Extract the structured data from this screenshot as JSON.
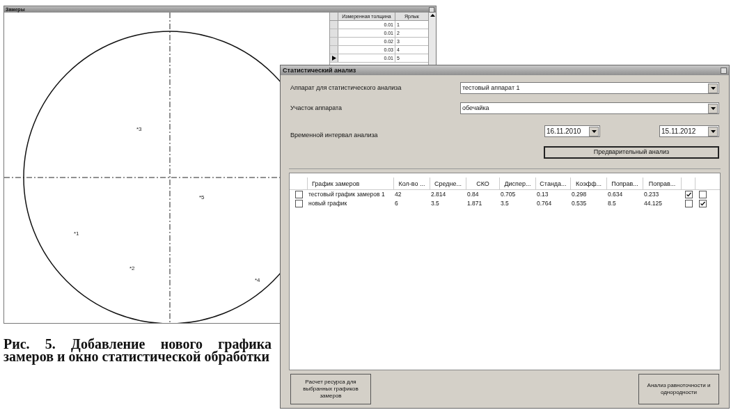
{
  "measurements_window": {
    "title": "Замеры",
    "plot": {
      "points": [
        {
          "label": "*1"
        },
        {
          "label": "*2"
        },
        {
          "label": "*3"
        },
        {
          "label": "*4"
        },
        {
          "label": "*5"
        }
      ]
    },
    "grid": {
      "columns": [
        "Измеренная толщина",
        "Ярлык"
      ],
      "rows": [
        {
          "values": [
            "0.01",
            "1"
          ],
          "current": false
        },
        {
          "values": [
            "0.01",
            "2"
          ],
          "current": false
        },
        {
          "values": [
            "0.02",
            "3"
          ],
          "current": false
        },
        {
          "values": [
            "0.03",
            "4"
          ],
          "current": false
        },
        {
          "values": [
            "0.01",
            "5"
          ],
          "current": true
        }
      ]
    }
  },
  "stats_window": {
    "title": "Статистический анализ",
    "fields": [
      {
        "label": "Аппарат для статистического анализа",
        "value": "тестовый аппарат 1"
      },
      {
        "label": "Участок аппарата",
        "value": "обечайка"
      }
    ],
    "interval": {
      "label": "Временной интервал анализа",
      "from": "16.11.2010",
      "to": "15.11.2012"
    },
    "preliminary_button": "Предварительный анализ",
    "table": {
      "columns": [
        "График замеров",
        "Кол-во ...",
        "Средне...",
        "СКО",
        "Диспер...",
        "Станда...",
        "Коэфф...",
        "Поправ...",
        "Поправ..."
      ],
      "rows": [
        {
          "checked": false,
          "cells": [
            "тестовый график замеров 1",
            "42",
            "2.814",
            "0.84",
            "0.705",
            "0.13",
            "0.298",
            "0.634",
            "0.233"
          ],
          "flag_1": true,
          "flag_2": false
        },
        {
          "checked": false,
          "cells": [
            "новый график",
            "6",
            "3.5",
            "1.871",
            "3.5",
            "0.764",
            "0.535",
            "8.5",
            "44.125"
          ],
          "flag_1": false,
          "flag_2": true
        }
      ]
    },
    "buttons": [
      "Расчет ресурса для выбранных графиков замеров",
      "Анализ равноточности и однородности"
    ]
  },
  "caption": "Рис. 5. Добавление нового графика замеров и окно статистической обработки"
}
